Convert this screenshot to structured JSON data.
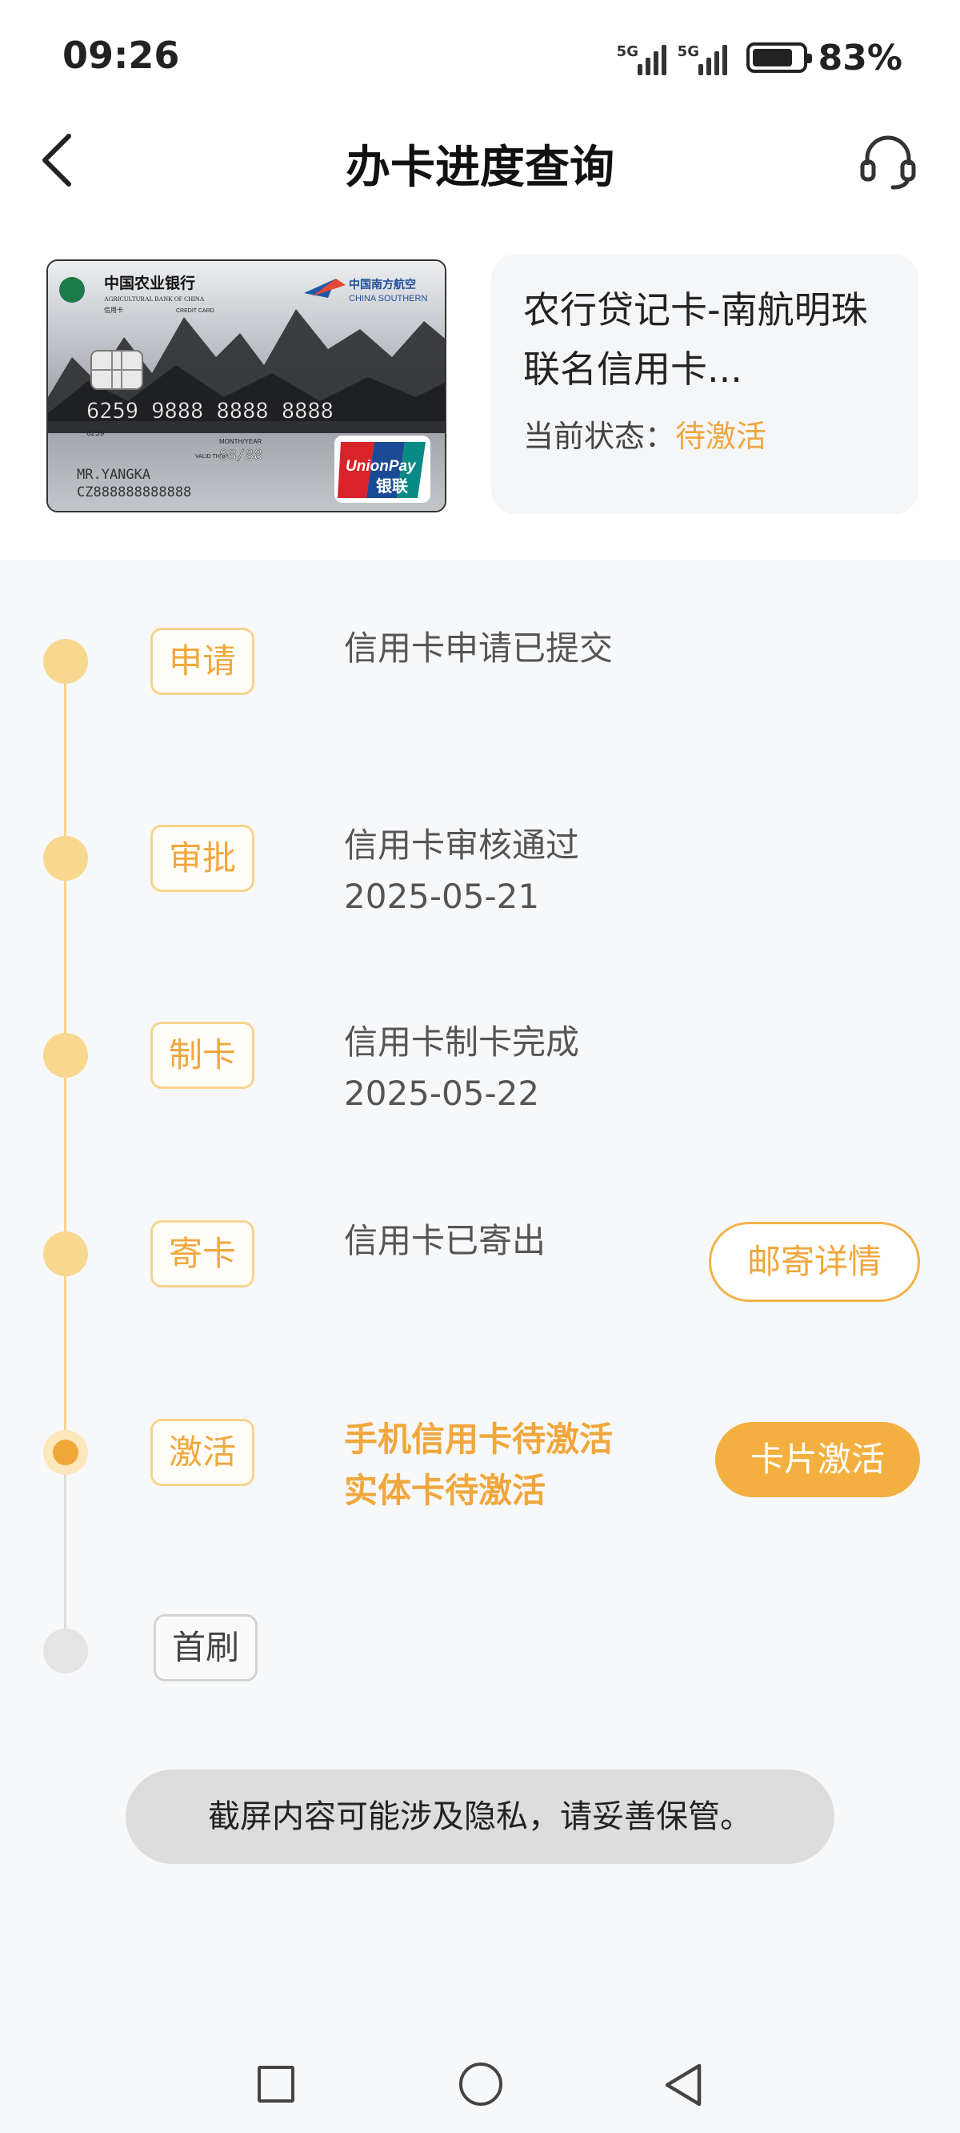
{
  "status_bar": {
    "time": "09:26",
    "signal1_label": "5G",
    "signal2_label": "5G",
    "battery_level_percent": 83,
    "battery_text": "83%"
  },
  "header": {
    "title": "办卡进度查询",
    "back_icon": "chevron-left-icon",
    "service_icon": "headset-icon"
  },
  "card": {
    "name": "农行贷记卡-南航明珠联名信用卡...",
    "status_label": "当前状态：",
    "status_value": "待激活",
    "image": {
      "bank_cn": "中国农业银行",
      "bank_en": "AGRICULTURAL BANK OF CHINA",
      "card_type_cn": "信用卡",
      "card_type_en": "CREDIT CARD",
      "airline_cn": "中国南方航空",
      "airline_en": "CHINA SOUTHERN",
      "number": "6259 9888 8888 8888",
      "number_small": "6259",
      "valid_label": "VALID THRU",
      "month_year_label": "MONTH/YEAR",
      "expiry": "88/88",
      "holder": "MR.YANGKA",
      "holder_code": "CZ888888888888",
      "unionpay_en": "UnionPay",
      "unionpay_cn": "银联"
    }
  },
  "timeline": {
    "steps": [
      {
        "tag": "申请",
        "line1": "信用卡申请已提交",
        "line2": "",
        "state": "done"
      },
      {
        "tag": "审批",
        "line1": "信用卡审核通过",
        "line2": "2025-05-21",
        "state": "done"
      },
      {
        "tag": "制卡",
        "line1": "信用卡制卡完成",
        "line2": "2025-05-22",
        "state": "done"
      },
      {
        "tag": "寄卡",
        "line1": "信用卡已寄出",
        "line2": "",
        "state": "done",
        "button": "邮寄详情"
      },
      {
        "tag": "激活",
        "line1": "手机信用卡待激活",
        "line2": "实体卡待激活",
        "state": "active",
        "button": "卡片激活"
      },
      {
        "tag": "首刷",
        "line1": "",
        "line2": "",
        "state": "pending"
      }
    ]
  },
  "toast": "截屏内容可能涉及隐私，请妥善保管。",
  "colors": {
    "accent": "#f0a73c",
    "accent_light": "#f6d48d",
    "button_fill": "#f3b040",
    "pending": "#dcdcdc"
  }
}
